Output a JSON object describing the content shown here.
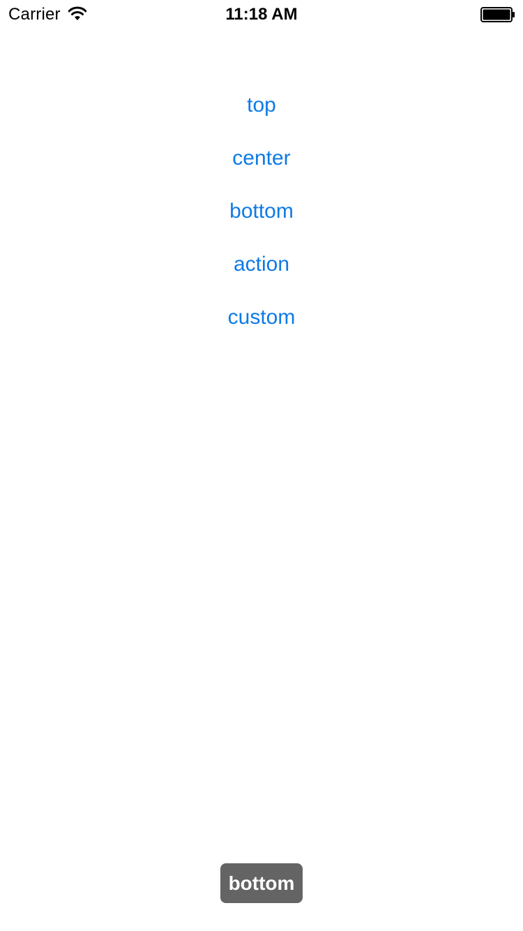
{
  "status_bar": {
    "carrier": "Carrier",
    "time": "11:18 AM",
    "wifi_icon": "wifi-icon",
    "battery_icon": "battery-icon"
  },
  "menu": {
    "items": [
      {
        "label": "top"
      },
      {
        "label": "center"
      },
      {
        "label": "bottom"
      },
      {
        "label": "action"
      },
      {
        "label": "custom"
      }
    ],
    "link_color": "#0e7ae5"
  },
  "toast": {
    "message": "bottom",
    "background": "#646464",
    "text_color": "#ffffff"
  }
}
